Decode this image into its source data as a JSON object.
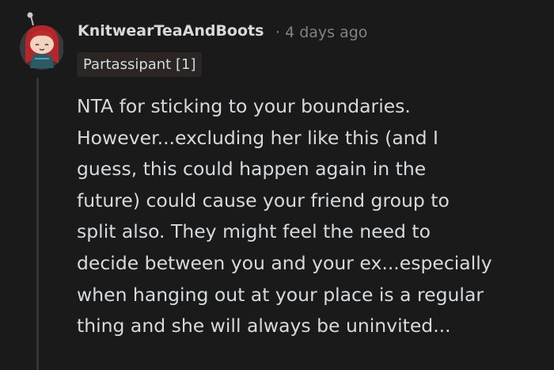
{
  "comment": {
    "author": "KnitwearTeaAndBoots",
    "separator": "·",
    "timestamp": "4 days ago",
    "flair": "Partassipant [1]",
    "avatar_icon": "snoo-avatar-red-hair-icon",
    "body_lines": [
      "NTA for sticking to your boundaries.",
      "However...excluding her like this (and I",
      "guess, this could happen again in the",
      "future) could cause your friend group to",
      "split also. They might feel the need to",
      "decide between you and your ex...especially",
      "when hanging out at your place is a regular",
      "thing and she will always be uninvited..."
    ]
  },
  "colors": {
    "background": "#1a1a1b",
    "text": "#d7dadc",
    "muted": "#818384",
    "flair_bg": "#2b2623",
    "thread_line": "#343536"
  }
}
